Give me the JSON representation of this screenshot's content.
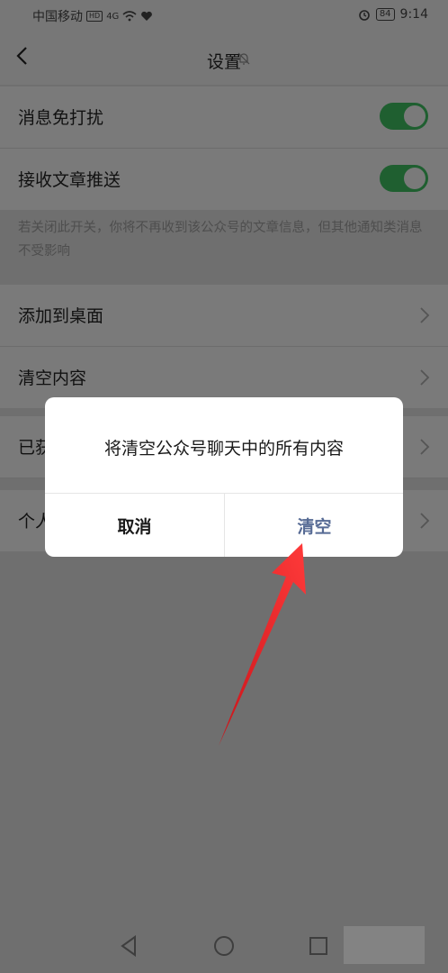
{
  "status_bar": {
    "carrier": "中国移动",
    "hd_badge": "HD",
    "signal": "4G",
    "battery": "84",
    "time": "9:14"
  },
  "nav": {
    "title": "设置"
  },
  "settings": {
    "dnd_label": "消息免打扰",
    "articles_label": "接收文章推送",
    "note": "若关闭此开关，你将不再收到该公众号的文章信息，但其他通知类消息不受影响",
    "add_desktop_label": "添加到桌面",
    "clear_content_label": "清空内容",
    "row3_partial_label": "已获",
    "row4_partial_label": "个人"
  },
  "dialog": {
    "message": "将清空公众号聊天中的所有内容",
    "cancel_label": "取消",
    "confirm_label": "清空"
  },
  "colors": {
    "confirm_button": "#576b95",
    "toggle_on": "#1f5f30",
    "annotation_arrow": "#e8262a"
  }
}
